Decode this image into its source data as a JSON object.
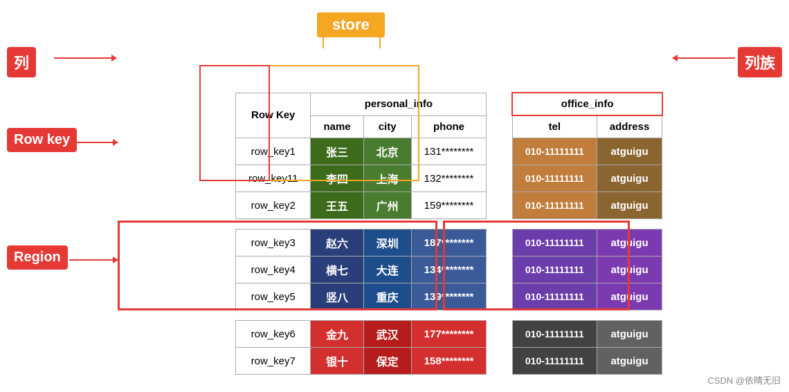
{
  "labels": {
    "lie": "列",
    "liezu": "列族",
    "rowkey": "Row key",
    "region": "Region",
    "store": "store",
    "personalInfo": "personal_info",
    "officeInfo": "office_info"
  },
  "headers": {
    "rowKey": "Row Key",
    "name": "name",
    "city": "city",
    "phone": "phone",
    "tel": "tel",
    "address": "address"
  },
  "rows": [
    {
      "key": "row_key1",
      "name": "张三",
      "city": "北京",
      "phone": "131********",
      "tel": "010-11111111",
      "address": "atguigu",
      "region": 1
    },
    {
      "key": "row_key11",
      "name": "李四",
      "city": "上海",
      "phone": "132********",
      "tel": "010-11111111",
      "address": "atguigu",
      "region": 1
    },
    {
      "key": "row_key2",
      "name": "王五",
      "city": "广州",
      "phone": "159********",
      "tel": "010-11111111",
      "address": "atguigu",
      "region": 1
    },
    {
      "key": "row_key3",
      "name": "赵六",
      "city": "深圳",
      "phone": "187********",
      "tel": "010-11111111",
      "address": "atguigu",
      "region": 2
    },
    {
      "key": "row_key4",
      "name": "横七",
      "city": "大连",
      "phone": "134********",
      "tel": "010-11111111",
      "address": "atguigu",
      "region": 2
    },
    {
      "key": "row_key5",
      "name": "竖八",
      "city": "重庆",
      "phone": "139********",
      "tel": "010-11111111",
      "address": "atguigu",
      "region": 2
    },
    {
      "key": "row_key6",
      "name": "金九",
      "city": "武汉",
      "phone": "177********",
      "tel": "010-11111111",
      "address": "atguigu",
      "region": 3
    },
    {
      "key": "row_key7",
      "name": "银十",
      "city": "保定",
      "phone": "158********",
      "tel": "010-11111111",
      "address": "atguigu",
      "region": 3
    }
  ],
  "watermark": "CSDN @依晴无旧",
  "colors": {
    "red": "#e53935",
    "orange": "#f5a623",
    "darkGreen": "#3d6b1c",
    "medGreen": "#4a7c2f",
    "brown": "#c17d3c",
    "darkBrown": "#8b6530",
    "darkBlue1": "#2a3f7a",
    "darkBlue2": "#1e4d8c",
    "medBlue": "#3a5a9a",
    "purple1": "#6b3dab",
    "purple2": "#7b3ab0",
    "darkGray1": "#424242",
    "darkGray2": "#616161"
  }
}
